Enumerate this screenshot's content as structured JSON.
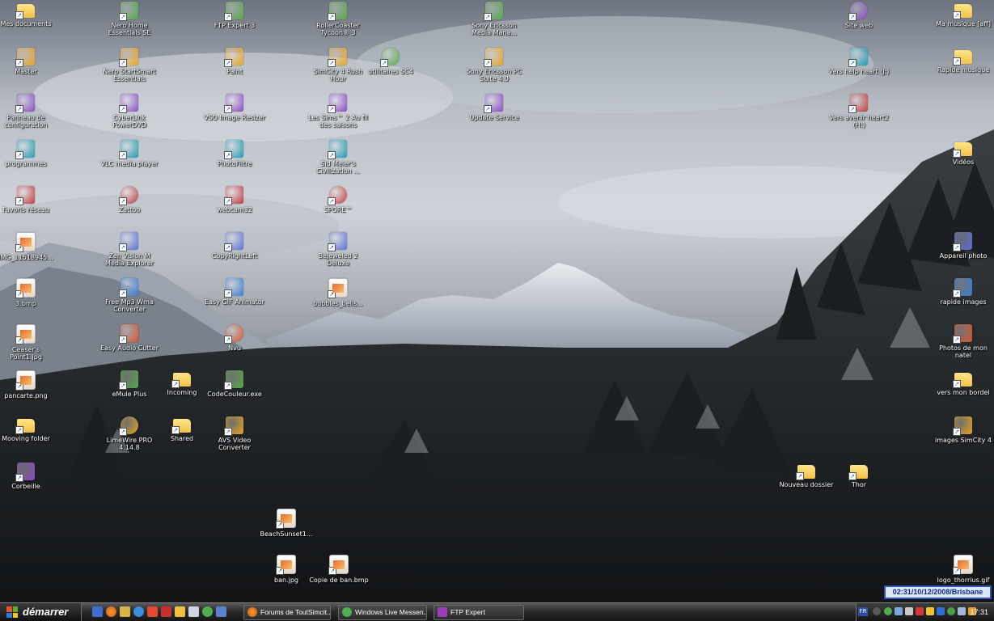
{
  "desktop": {
    "icons_col1": [
      {
        "label": "Mes documents",
        "icon": "folder-docs-icon"
      },
      {
        "label": "Master",
        "icon": "windows-flag-icon"
      },
      {
        "label": "Panneau de configuration",
        "icon": "control-panel-icon"
      },
      {
        "label": "programmes",
        "icon": "programs-icon"
      },
      {
        "label": "Favoris réseau",
        "icon": "network-icon"
      },
      {
        "label": "IMG_11518945...",
        "icon": "image-file-icon"
      },
      {
        "label": "3.bmp",
        "icon": "bitmap-file-icon"
      },
      {
        "label": "Ceaser's Point1.jpg",
        "icon": "image-file-icon"
      },
      {
        "label": "pancarte.png",
        "icon": "image-file-icon"
      },
      {
        "label": "Mooving folder",
        "icon": "folder-icon"
      },
      {
        "label": "Corbeille",
        "icon": "recycle-bin-icon"
      }
    ],
    "icons_col2": [
      {
        "label": "Nero Home Essentials SE",
        "icon": "nero-home-icon"
      },
      {
        "label": "Nero StartSmart Essentials",
        "icon": "nero-startsmart-icon"
      },
      {
        "label": "CyberLink PowerDVD",
        "icon": "powerdvd-icon"
      },
      {
        "label": "VLC media player",
        "icon": "vlc-cone-icon"
      },
      {
        "label": "Zattoo",
        "icon": "zattoo-icon"
      },
      {
        "label": "Zen Vision M Media Explorer",
        "icon": "media-explorer-icon"
      },
      {
        "label": "Free Mp3 Wma Converter",
        "icon": "converter-icon"
      },
      {
        "label": "Easy Audio Cutter",
        "icon": "audio-cutter-icon"
      },
      {
        "label": "eMule Plus",
        "icon": "emule-icon"
      },
      {
        "label": "LimeWire PRO 4.14.8",
        "icon": "limewire-icon"
      }
    ],
    "icons_col2b": [
      {
        "label": "Incoming",
        "icon": "folder-icon"
      },
      {
        "label": "Shared",
        "icon": "folder-icon"
      }
    ],
    "icons_col3": [
      {
        "label": "FTP Expert 3",
        "icon": "ftp-icon"
      },
      {
        "label": "Paint",
        "icon": "paint-icon"
      },
      {
        "label": "VSO Image Resizer",
        "icon": "image-resizer-icon"
      },
      {
        "label": "PhotoFiltre",
        "icon": "photofiltre-icon"
      },
      {
        "label": "webcam32",
        "icon": "webcam-icon"
      },
      {
        "label": "CopyRightLeft",
        "icon": "copyright-icon"
      },
      {
        "label": "Easy GIF Animator",
        "icon": "gif-animator-icon"
      },
      {
        "label": "Nvu",
        "icon": "nvu-icon"
      },
      {
        "label": "CodeCouleur.exe",
        "icon": "color-code-icon"
      },
      {
        "label": "AVS Video Converter",
        "icon": "video-converter-icon"
      }
    ],
    "icons_col4": [
      {
        "label": "RollerCoaster Tycoon® 3",
        "icon": "rollercoaster-icon"
      },
      {
        "label": "SimCity 4 Rush Hour",
        "icon": "simcity-icon"
      },
      {
        "label": "Les Sims™ 2 Au fil des saisons",
        "icon": "sims-icon"
      },
      {
        "label": "Sid Meier's Civilization ...",
        "icon": "civilization-icon"
      },
      {
        "label": "SPORE™",
        "icon": "spore-icon"
      },
      {
        "label": "Bejeweled 2 Deluxe",
        "icon": "bejeweled-icon"
      },
      {
        "label": "bubbles_belis...",
        "icon": "image-file-icon"
      }
    ],
    "icons_col5": [
      {
        "label": "utilitaires SC4",
        "icon": "gear-icon"
      }
    ],
    "icons_col6": [
      {
        "label": "Sony Ericsson Media Mana...",
        "icon": "sony-media-icon"
      },
      {
        "label": "Sony Ericsson PC Suite 4.0",
        "icon": "sony-pcsuite-icon"
      },
      {
        "label": "Update Service",
        "icon": "update-service-icon"
      }
    ],
    "icons_right1": [
      {
        "label": "Site web",
        "icon": "ie-globe-icon"
      },
      {
        "label": "Vers help heart (J:)",
        "icon": "network-drive-icon"
      },
      {
        "label": "Vers avenir heart2 (H:)",
        "icon": "network-drive-icon"
      }
    ],
    "icons_right2": [
      {
        "label": "Ma musique [aff]",
        "icon": "music-folder-icon"
      },
      {
        "label": "Rapide musique",
        "icon": "music-folder-icon"
      },
      {
        "label": "Vidéos",
        "icon": "folder-icon"
      },
      {
        "label": "Appareil photo",
        "icon": "camera-icon"
      },
      {
        "label": "rapide images",
        "icon": "camera-icon"
      },
      {
        "label": "Photos de mon natel",
        "icon": "phone-icon"
      },
      {
        "label": "vers mon bordel",
        "icon": "image-folder-icon"
      },
      {
        "label": "images SimCity 4",
        "icon": "simcity-images-icon"
      },
      {
        "label": "logo_thorrius.gif",
        "icon": "image-file-icon"
      }
    ],
    "icons_mid": [
      {
        "label": "BeachSunset1...",
        "icon": "image-file-icon"
      },
      {
        "label": "ban.jpg",
        "icon": "image-file-icon"
      },
      {
        "label": "Copie de ban.bmp",
        "icon": "bitmap-file-icon"
      },
      {
        "label": "Nouveau dossier",
        "icon": "folder-icon"
      },
      {
        "label": "Thor",
        "icon": "folder-icon"
      }
    ],
    "clock_widget": "02:31/10/12/2008/Brisbane"
  },
  "taskbar": {
    "start_label": "démarrer",
    "tasks": [
      {
        "label": "Forums de ToutSimcit...",
        "icon": "firefox-icon"
      },
      {
        "label": "Windows Live Messen...",
        "icon": "messenger-icon"
      },
      {
        "label": "FTP Expert",
        "icon": "ftp-icon"
      }
    ],
    "language": "FR",
    "time": "17:31"
  },
  "colors": {
    "clock_border": "#2d54b5",
    "clock_text": "#0c2a84"
  }
}
